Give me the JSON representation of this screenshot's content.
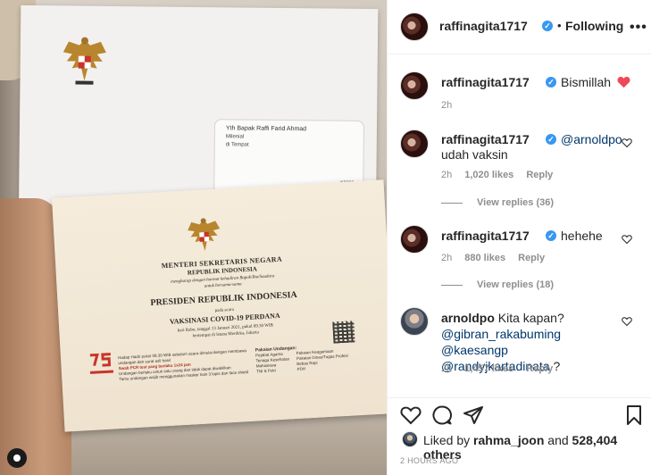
{
  "photo": {
    "envelope": {
      "recipient": "Yth Bapak Raffi Farid Ahmad",
      "line2": "Milenial",
      "line3": "di Tempat",
      "code": "KP009"
    },
    "card": {
      "minister": "MENTERI SEKRETARIS NEGARA",
      "republik": "REPUBLIK INDONESIA",
      "invite_line1": "mengharap dengan hormat kehadiran Bapak/Ibu/Saudara",
      "invite_line2": "untuk bersama-sama",
      "president": "PRESIDEN REPUBLIK INDONESIA",
      "pada_acara": "pada acara",
      "event": "VAKSINASI COVID-19 PERDANA",
      "date": "hari Rabu, tanggal 13 Januari 2021, pukul 09.30 WIB",
      "place": "bertempat di Istana Merdeka, Jakarta",
      "notes_1": "Hadap Hadir pukul 08.30 WIB sebelum acara dimulai dengan membawa undangan dan surat asli hasil",
      "notes_2": "Swab PCR test yang berlaku 1x24 jam",
      "notes_3": "Undangan berlaku untuk satu orang dan tidak dapat diwakilkan",
      "notes_4": "Tamu undangan wajib menggunakan masker kain 3 lapis dan face shield",
      "pakaian_title": "Pakaian Undangan:",
      "pakaian_1": "Pejabat Agama",
      "pakaian_2": "Tenaga Kesehatan",
      "pakaian_3": "Mahasiswa",
      "pakaian_4": "TNI & Polri",
      "pakaian_5": "Pakaian Keagamaan",
      "pakaian_6": "Pakaian Dinas/Tugas Profesi",
      "pakaian_7": "Bebas Rapi",
      "pakaian_8": "PDH"
    }
  },
  "header": {
    "username": "raffinagita1717",
    "dot": "•",
    "following": "Following",
    "more": "•••"
  },
  "caption": {
    "username": "raffinagita1717",
    "text": "Bismillah",
    "time": "2h"
  },
  "comments": [
    {
      "username": "raffinagita1717",
      "mention": "@arnoldpo",
      "text": "udah vaksin",
      "time": "2h",
      "likes": "1,020 likes",
      "reply": "Reply",
      "view_replies": "View replies (36)"
    },
    {
      "username": "raffinagita1717",
      "text": "hehehe",
      "time": "2h",
      "likes": "880 likes",
      "reply": "Reply",
      "view_replies": "View replies (18)"
    },
    {
      "username": "arnoldpo",
      "text": "Kita kapan?",
      "mention1": "@gibran_rakabuming",
      "mention2": "@kaesangp",
      "mention3": "@randyjkartadinata",
      "tail": "?",
      "time": "2h",
      "likes": "1,457 likes",
      "reply": "Reply"
    }
  ],
  "liked_by": {
    "prefix": "Liked by",
    "user": "rahma_joon",
    "and": "and",
    "others": "528,404 others"
  },
  "timestamp": "2 HOURS AGO",
  "colors": {
    "verified": "#3897f0",
    "heart_red": "#ed4956",
    "mention": "#00376b",
    "secondary_text": "#8e8e8e"
  }
}
